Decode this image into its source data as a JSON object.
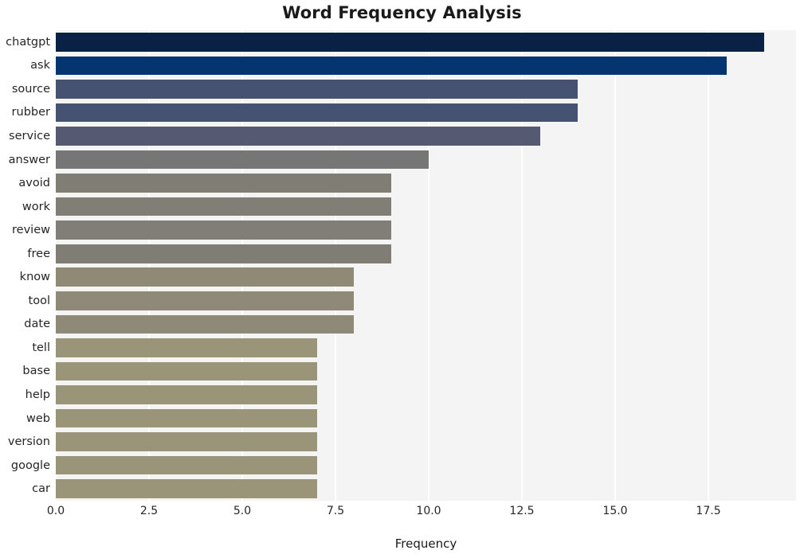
{
  "chart_data": {
    "type": "bar",
    "orientation": "horizontal",
    "title": "Word Frequency Analysis",
    "xlabel": "Frequency",
    "ylabel": "",
    "categories": [
      "chatgpt",
      "ask",
      "source",
      "rubber",
      "service",
      "answer",
      "avoid",
      "work",
      "review",
      "free",
      "know",
      "tool",
      "date",
      "tell",
      "base",
      "help",
      "web",
      "version",
      "google",
      "car"
    ],
    "values": [
      19,
      18,
      14,
      14,
      13,
      10,
      9,
      9,
      9,
      9,
      8,
      8,
      8,
      7,
      7,
      7,
      7,
      7,
      7,
      7
    ],
    "bar_colors": [
      "#0a2146",
      "#053571",
      "#465272",
      "#465272",
      "#555a72",
      "#767676",
      "#7f7d74",
      "#807e75",
      "#807e76",
      "#807d74",
      "#8e8a76",
      "#8e8a77",
      "#8f8a77",
      "#9a9478",
      "#9a9478",
      "#9a9478",
      "#9a9478",
      "#9a9478",
      "#9a9478",
      "#9a9478"
    ],
    "xlim": [
      0,
      19.85
    ],
    "xticks": [
      0.0,
      2.5,
      5.0,
      7.5,
      10.0,
      12.5,
      15.0,
      17.5
    ],
    "xtick_labels": [
      "0.0",
      "2.5",
      "5.0",
      "7.5",
      "10.0",
      "12.5",
      "15.0",
      "17.5"
    ],
    "grid": true,
    "grid_axis": "x",
    "grid_color": "#ffffff",
    "plot_background": "#f4f4f4",
    "figure_background": "#ffffff",
    "legend": null
  }
}
